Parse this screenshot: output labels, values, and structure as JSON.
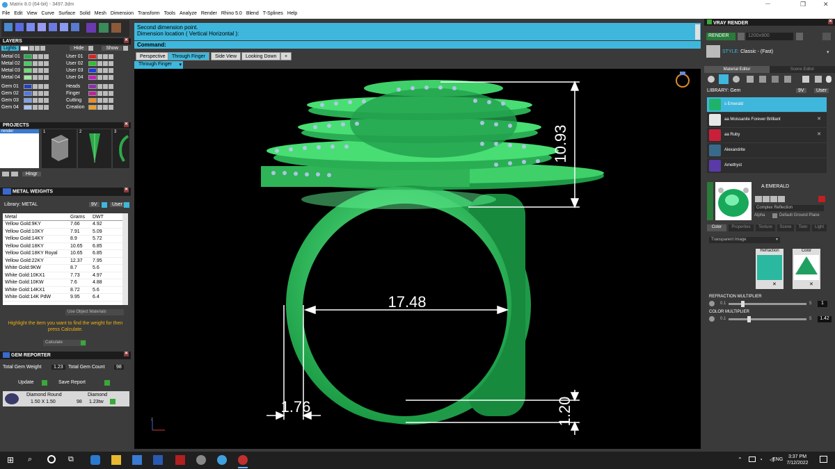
{
  "window": {
    "title": "Matrix 8.0 (64-bit) - 3497.3dm"
  },
  "menu": [
    "File",
    "Edit",
    "View",
    "Curve",
    "Surface",
    "Solid",
    "Mesh",
    "Dimension",
    "Transform",
    "Tools",
    "Analyze",
    "Render",
    "Rhino 5.0",
    "Blend",
    "T-Splines",
    "Help"
  ],
  "layers": {
    "title": "LAYERS",
    "lights_label": "Lights",
    "hide_label": "Hide",
    "show_label": "Show",
    "left": [
      {
        "name": "Metal 01",
        "color": "#22b04a"
      },
      {
        "name": "Metal 02",
        "color": "#3cd25c"
      },
      {
        "name": "Metal 03",
        "color": "#66e36c"
      },
      {
        "name": "Metal 04",
        "color": "#9cef9c"
      },
      {
        "name": "Gem 01",
        "color": "#1f40c8"
      },
      {
        "name": "Gem 02",
        "color": "#4f78e8"
      },
      {
        "name": "Gem 03",
        "color": "#7aa2f4"
      },
      {
        "name": "Gem 04",
        "color": "#a8c4fa"
      }
    ],
    "right": [
      {
        "name": "User 01",
        "color": "#e02020"
      },
      {
        "name": "User 02",
        "color": "#2ec02e"
      },
      {
        "name": "User 03",
        "color": "#1f3adf"
      },
      {
        "name": "User 04",
        "color": "#c020c0"
      },
      {
        "name": "Heads",
        "color": "#8a2fb0"
      },
      {
        "name": "Finger",
        "color": "#c0209a"
      },
      {
        "name": "Cutting",
        "color": "#f08c20"
      },
      {
        "name": "Creation",
        "color": "#f0a020"
      }
    ]
  },
  "projects": {
    "title": "PROJECTS",
    "item": "render",
    "slots": [
      "1",
      "2",
      "3"
    ],
    "hinge_label": "Hingr"
  },
  "metal_weights": {
    "title": "METAL WEIGHTS",
    "library_label": "Library: METAL",
    "toggle_a": "9V",
    "toggle_b": "User",
    "headers": [
      "Metal",
      "Grams",
      "DWT"
    ],
    "rows": [
      [
        "Yellow Gold:9KY",
        "7.66",
        "4.92"
      ],
      [
        "Yellow Gold:10KY",
        "7.91",
        "5.09"
      ],
      [
        "Yellow Gold:14KY",
        "8.9",
        "5.72"
      ],
      [
        "Yellow Gold:18KY",
        "10.65",
        "6.85"
      ],
      [
        "Yellow Gold:18KY Royal",
        "10.65",
        "6.85"
      ],
      [
        "Yellow Gold:22KY",
        "12.37",
        "7.95"
      ],
      [
        "White Gold:9KW",
        "8.7",
        "5.6"
      ],
      [
        "White Gold:10KX1",
        "7.73",
        "4.97"
      ],
      [
        "White Gold:10KW",
        "7.6",
        "4.88"
      ],
      [
        "White Gold:14KX1",
        "8.72",
        "5.6"
      ],
      [
        "White Gold:14K PdW",
        "9.95",
        "6.4"
      ]
    ],
    "use_object_materials": "Use Object Materials",
    "hint": "Highlight the item you want to find the weight for then press Calculate.",
    "calculate": "Calculate"
  },
  "gem_reporter": {
    "title": "GEM REPORTER",
    "total_weight_label": "Total Gem Weight",
    "total_weight": "1.23",
    "total_count_label": "Total Gem Count",
    "total_count": "98",
    "update": "Update",
    "save_report": "Save Report",
    "gem_name": "Diamond Round",
    "gem_size": "1.50 X 1.50",
    "gem_type": "Diamond",
    "gem_count": "98",
    "gem_tw": "1.23tw"
  },
  "command": {
    "line1": "Second dimension point.",
    "line2": "Dimension location ( Vertical  Horizontal ):",
    "prompt": "Command:"
  },
  "viewport": {
    "tabs": [
      "Perspective",
      "Through Finger",
      "Side View",
      "Looking Down",
      "+"
    ],
    "active_tab": "Through Finger",
    "view_selector": "Through Finger",
    "dim_top": "10.93",
    "dim_diameter": "17.48",
    "dim_width": "1.76",
    "dim_thickness": "1.20",
    "axis": "z"
  },
  "vray": {
    "title": "VRAY RENDER",
    "render_label": "RENDER",
    "resolution": "1200x900",
    "style": "Classic - (Fast)",
    "tabs": [
      "Material Editor",
      "Scene Editor"
    ],
    "library_label": "LIBRARY: Gem",
    "toggle_a": "9V",
    "toggle_b": "User",
    "materials": [
      {
        "name": "s Emerald",
        "color": "#1fb36a",
        "selected": true
      },
      {
        "name": "aa Moissanite Forever Brilliant",
        "color": "#e8e8e8",
        "selected": false
      },
      {
        "name": "aa Ruby",
        "color": "#c8203a",
        "selected": false
      },
      {
        "name": "Alexandrite",
        "color": "#3a6a8a",
        "selected": false
      },
      {
        "name": "Amethyst",
        "color": "#5a3aa8",
        "selected": false
      }
    ],
    "preview_title": "A EMERALD",
    "reflection": "Complex Reflection",
    "alpha_label": "Alpha",
    "ground": "Default Ground Plane",
    "prop_tabs": [
      "Color",
      "Properties",
      "Texture",
      "Scene",
      "Toon",
      "Light"
    ],
    "transparency": "Transparent Image",
    "refraction_label": "Refraction",
    "color_label": "Color",
    "refraction_multiplier_label": "REFRACTION MULTIPLIER",
    "refraction_min": "0.1",
    "refraction_max": "5",
    "refraction_value": "1",
    "color_multiplier_label": "COLOR MULTIPLIER",
    "color_min": "0.1",
    "color_max": "5",
    "color_value": "1.42"
  },
  "taskbar": {
    "lang": "ENG",
    "time": "3:37 PM",
    "date": "7/12/2022"
  }
}
